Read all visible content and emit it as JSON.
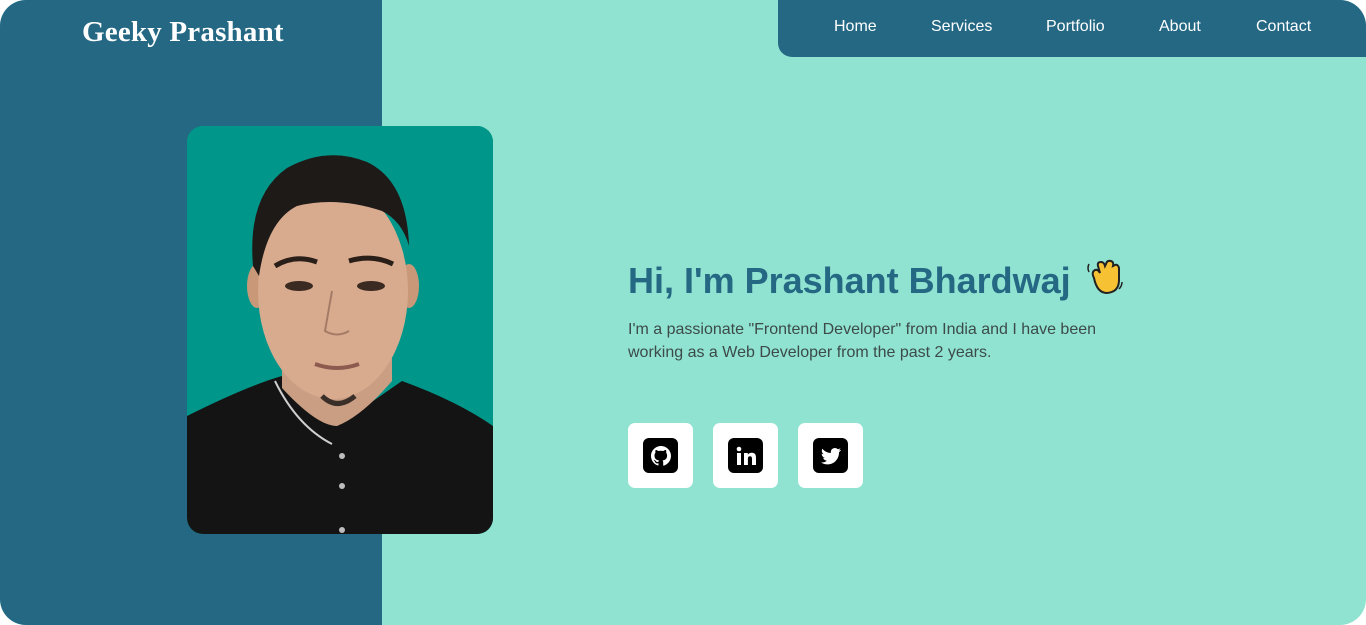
{
  "site": {
    "logo": "Geeky Prashant"
  },
  "nav": {
    "items": [
      {
        "label": "Home"
      },
      {
        "label": "Services"
      },
      {
        "label": "Portfolio"
      },
      {
        "label": "About"
      },
      {
        "label": "Contact"
      }
    ]
  },
  "hero": {
    "heading": "Hi, I'm Prashant Bhardwaj",
    "wave_icon": "waving-hand-icon",
    "bio_line1": "I'm a passionate \"Frontend Developer\" from India and I have been",
    "bio_line2": "working as a Web Developer from the past 2 years."
  },
  "social": [
    {
      "icon": "github-icon"
    },
    {
      "icon": "linkedin-icon"
    },
    {
      "icon": "twitter-icon"
    }
  ],
  "colors": {
    "primary": "#246884",
    "background": "#90e3d0",
    "photo_bg": "#00978a"
  }
}
